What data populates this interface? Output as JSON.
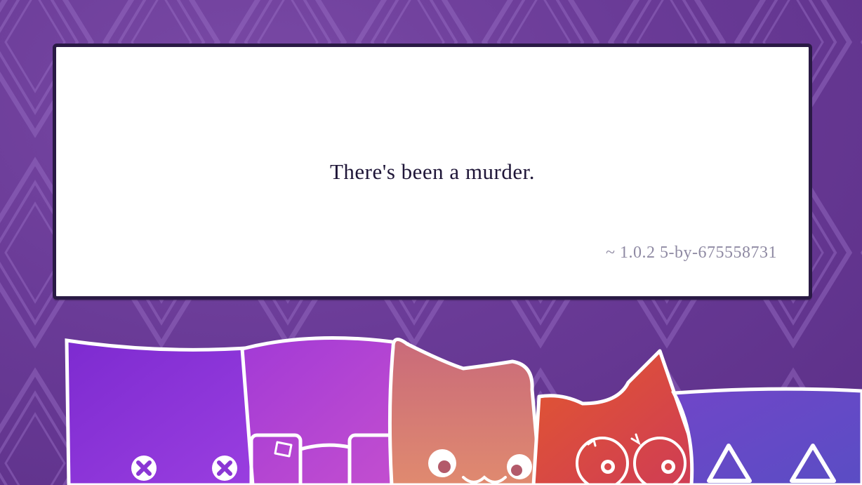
{
  "intro": {
    "headline": "There's been a murder.",
    "version": "~ 1.0.2 5-by-675558731"
  },
  "colors": {
    "background": "#6a3b97",
    "panel": "#ffffff",
    "panel_border": "#2a1a45",
    "headline_text": "#1f1638",
    "version_text": "#8f8aa3"
  }
}
